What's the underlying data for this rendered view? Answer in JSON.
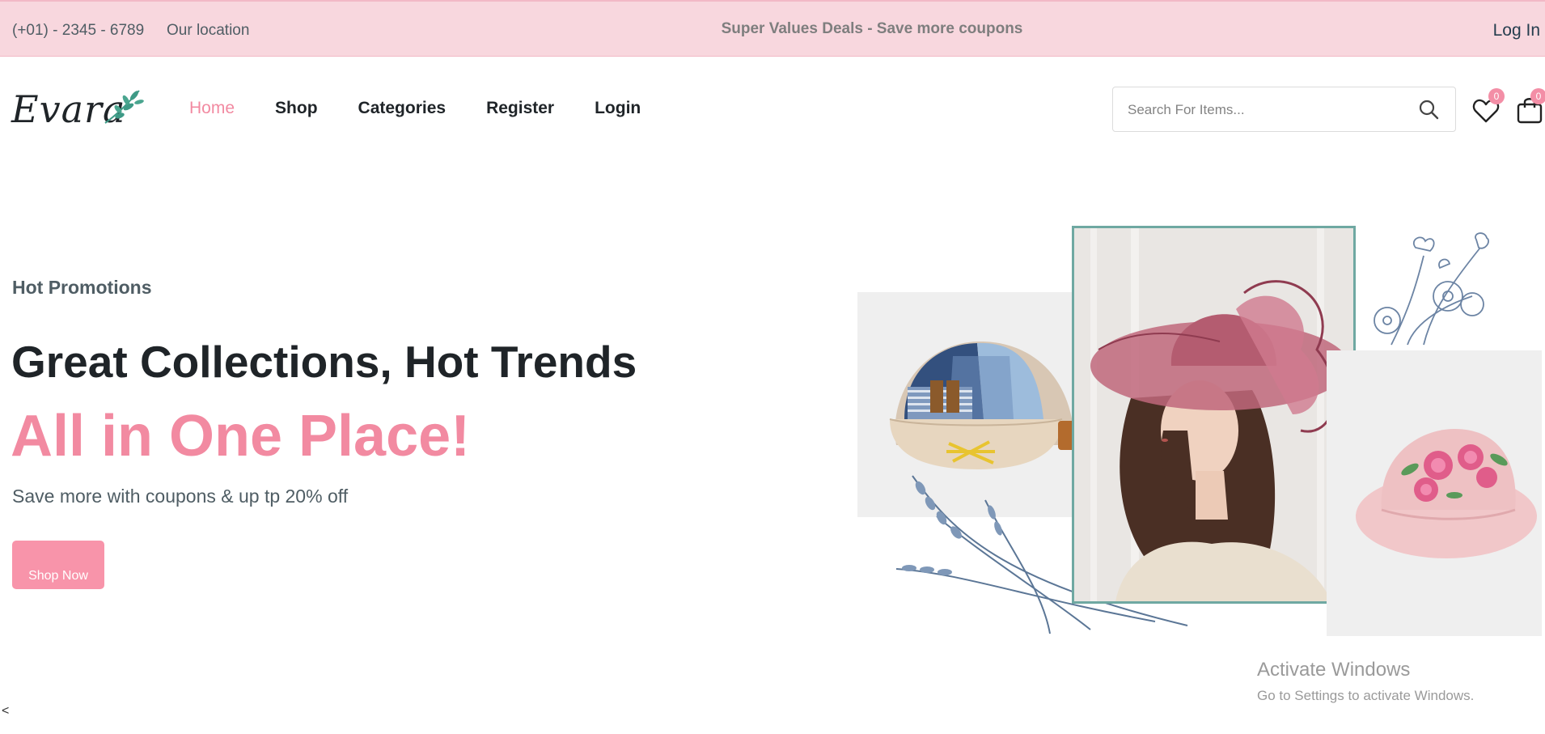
{
  "topbar": {
    "phone": "(+01) - 2345 - 6789",
    "location": "Our location",
    "deal": "Super Values Deals - Save more coupons",
    "login": "Log In"
  },
  "header": {
    "logo_text": "Evara",
    "nav": [
      "Home",
      "Shop",
      "Categories",
      "Register",
      "Login"
    ],
    "search_placeholder": "Search For Items...",
    "wishlist_count": "0",
    "cart_count": "0"
  },
  "hero": {
    "subtitle": "Hot Promotions",
    "title": "Great Collections, Hot Trends",
    "title_highlight": "All in One Place!",
    "description": "Save more with coupons & up tp 20% off",
    "button": "Shop Now",
    "slider_prev": "<"
  },
  "watermark": {
    "line1": "Activate Windows",
    "line2": "Go to Settings to activate Windows."
  },
  "colors": {
    "accent": "#f28aa1",
    "topbar_bg": "#f8d7de",
    "frame": "#6fa8a2"
  }
}
